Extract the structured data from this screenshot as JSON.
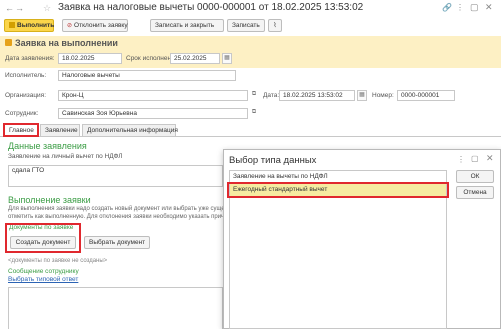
{
  "window": {
    "title": "Заявка на налоговые вычеты 0000-000001 от 18.02.2025 13:53:02"
  },
  "toolbar": {
    "execute_label": "Выполнить",
    "reject_label": "Отклонить заявку",
    "save_close_label": "Записать и закрыть",
    "save_label": "Записать"
  },
  "status": {
    "title": "Заявка на выполнении",
    "date_label": "Дата заявления:",
    "date_value": "18.02.2025",
    "deadline_label": "Срок исполнения:",
    "deadline_value": "25.02.2025",
    "executor_label": "Исполнитель:",
    "executor_value": "Налоговые вычеты"
  },
  "header": {
    "org_label": "Организация:",
    "org_value": "Крон-Ц",
    "date_label": "Дата:",
    "date_value": "18.02.2025 13:53:02",
    "number_label": "Номер:",
    "number_value": "0000-000001",
    "employee_label": "Сотрудник:",
    "employee_value": "Савинская Зоя Юрьевна"
  },
  "tabs": [
    {
      "label": "Главное"
    },
    {
      "label": "Заявление"
    },
    {
      "label": "Дополнительная информация"
    }
  ],
  "main": {
    "data_heading": "Данные заявления",
    "statement_text": "Заявление на личный вычет по НДФЛ",
    "statement_field": "сдала ГТО",
    "execution_heading": "Выполнение заявки",
    "execution_hint_1": "Для выполнения заявки надо создать новый документ или выбрать уже существ",
    "execution_hint_2": "отметить как выполненную. Для отклонения заявки необходимо указать причину",
    "docs_label": "Документы по заявке",
    "create_doc_label": "Создать документ",
    "choose_doc_label": "Выбрать документ",
    "no_docs_text": "<документы по заявке не созданы>",
    "message_heading": "Сообщение сотруднику",
    "template_link": "Выбрать типовой ответ"
  },
  "dialog": {
    "title": "Выбор типа данных",
    "items": [
      {
        "label": "Заявление на вычеты по НДФЛ"
      },
      {
        "label": "Ежегодный стандартный вычет"
      }
    ],
    "ok_label": "ОК",
    "cancel_label": "Отмена"
  }
}
